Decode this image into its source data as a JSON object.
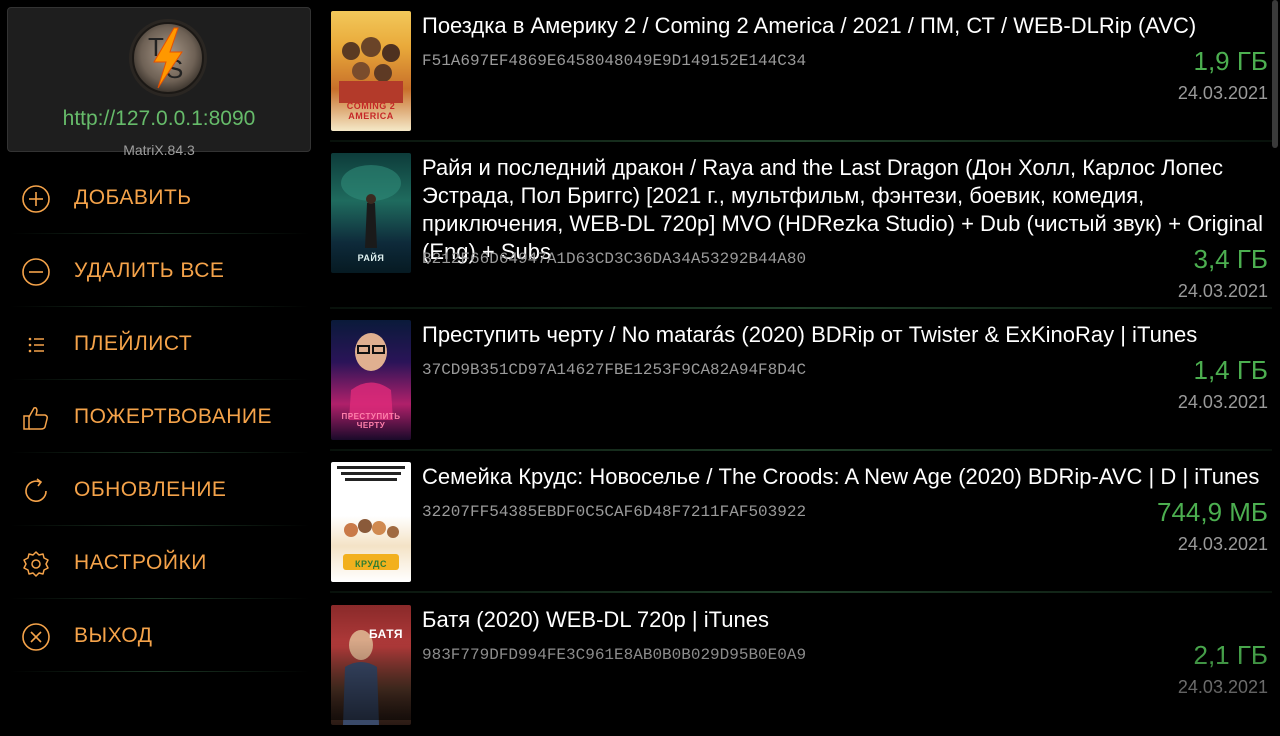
{
  "server": {
    "logo_text": "TS",
    "url": "http://127.0.0.1:8090",
    "version": "MatriX.84.3"
  },
  "menu": [
    {
      "label": "ДОБАВИТЬ",
      "icon": "plus-circle-icon"
    },
    {
      "label": "УДАЛИТЬ ВСЕ",
      "icon": "minus-circle-icon"
    },
    {
      "label": "ПЛЕЙЛИСТ",
      "icon": "list-icon"
    },
    {
      "label": "ПОЖЕРТВОВАНИЕ",
      "icon": "thumbs-up-icon"
    },
    {
      "label": "ОБНОВЛЕНИЕ",
      "icon": "refresh-icon"
    },
    {
      "label": "НАСТРОЙКИ",
      "icon": "gear-icon"
    },
    {
      "label": "ВЫХОД",
      "icon": "close-circle-icon"
    }
  ],
  "colors": {
    "menu_text": "#f5a34a",
    "size_text": "#4caf50",
    "url_text": "#66bb6a"
  },
  "torrents": [
    {
      "title": "Поездка в Америку 2 / Coming 2 America / 2021 / ПМ, СТ / WEB-DLRip (AVC)",
      "hash": "F51A697EF4869E6458048049E9D149152E144C34",
      "size": "1,9 ГБ",
      "date": "24.03.2021",
      "poster_caption": "COMING 2 AMERICA"
    },
    {
      "title": "Райя и последний дракон / Raya and the Last Dragon (Дон Холл, Карлос Лопес Эстрада, Пол Бриггс) [2021 г., мультфильм, фэнтези, боевик, комедия, приключения, WEB-DL 720p] MVO (HDRezka Studio) + Dub (чистый звук) + Original (Eng) + Subs",
      "hash": "B212F66D64947A1D63CD3C36DA34A53292B44A80",
      "size": "3,4 ГБ",
      "date": "24.03.2021",
      "poster_caption": "РАЙЯ"
    },
    {
      "title": "Преступить черту / No matarás (2020) BDRip от Twister & ExKinoRay | iTunes",
      "hash": "37CD9B351CD97A14627FBE1253F9CA82A94F8D4C",
      "size": "1,4 ГБ",
      "date": "24.03.2021",
      "poster_caption": "ПРЕСТУПИТЬ ЧЕРТУ"
    },
    {
      "title": "Семейка Крудс: Новоселье / The Croods: A New Age (2020) BDRip-AVC | D | iTunes",
      "hash": "32207FF54385EBDF0C5CAF6D48F7211FAF503922",
      "size": "744,9 МБ",
      "date": "24.03.2021",
      "poster_caption": "КРУДС"
    },
    {
      "title": "Батя (2020) WEB-DL 720p | iTunes",
      "hash": "983F779DFD994FE3C961E8AB0B0B029D95B0E0A9",
      "size": "2,1 ГБ",
      "date": "24.03.2021",
      "poster_caption": "БАТЯ"
    }
  ]
}
